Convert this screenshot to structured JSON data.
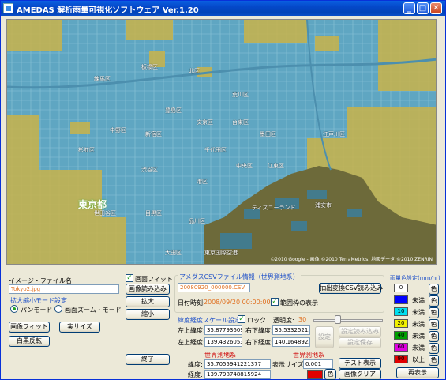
{
  "window": {
    "title": "AMEDAS 解析雨量可視化ソフトウェア Ver.1.20",
    "minimize": "_",
    "maximize": "□",
    "close": "✕"
  },
  "map": {
    "labels": [
      "東京都",
      "ディズニーランド",
      "浦安市",
      "東京国際空港",
      "江東区",
      "品川区",
      "目黒区",
      "渋谷区",
      "新宿区",
      "中野区",
      "杉並区",
      "練馬区",
      "板橋区",
      "北区",
      "荒川区",
      "台東区",
      "墨田区",
      "江戸川区",
      "大田区",
      "世田谷区",
      "豊島区",
      "文京区",
      "千代田区",
      "中央区",
      "港区"
    ],
    "copyright": "©2010 Google - 画像 ©2010 TerraMetrics, 地図データ ©2010 ZENRIN"
  },
  "image_panel": {
    "file_label": "イメージ・ファイル名",
    "file_value": "Tokyo2.jpg",
    "fit_check_label": "画面フィット",
    "fit_checked": true,
    "load_button": "画像読み込み",
    "zoom_in": "拡大",
    "zoom_out": "縮小",
    "zoom_mode_label": "拡大縮小モード設定",
    "pan_mode": "パンモード",
    "zoom_mode": "画面ズーム・モード",
    "fit_button": "画像フィット",
    "actual_size_button": "実サイズ",
    "invert_button": "白黒反転",
    "exit_button": "終了"
  },
  "csv_panel": {
    "title": "アメダスCSVファイル情報（世界測地系）",
    "file_value": "20080920_000000.CSV",
    "extract_button": "抽出変換CSV読み込み",
    "datetime_label": "日付時刻:",
    "datetime_value": "2008/09/20 00:00:00",
    "range_check_label": "範囲枠の表示",
    "range_checked": true
  },
  "latlon_panel": {
    "title": "緯度経度スケール設定",
    "lock_label": "ロック",
    "lock_checked": true,
    "transparency_label": "透明度:",
    "transparency_value": "30",
    "ul_lat_label": "左上緯度:",
    "ul_lat_value": "35.8779360901",
    "lr_lat_label": "右下緯度:",
    "lr_lat_value": "35.5332521541",
    "ul_lon_label": "左上経度:",
    "ul_lon_value": "139.432605398",
    "lr_lon_label": "右下経度:",
    "lr_lon_value": "140.164892233",
    "set_button": "設定",
    "load_settings": "設定読み込み",
    "save_settings": "設定保存"
  },
  "world_panel": {
    "title": "世界測地系",
    "lat_label": "緯度:",
    "lat_value": "35.7055941221377",
    "lon_label": "経度:",
    "lon_value": "139.798748815924",
    "title2": "世界測地系",
    "display_size_label": "表示サイズ:",
    "display_size_value": "0.001",
    "color_button": "色",
    "test_button": "テスト表示",
    "clear_button": "画像クリア",
    "marker_color": "#e00000"
  },
  "rain_panel": {
    "title": "雨量色設定(mm/hr)",
    "rows": [
      {
        "value": "0",
        "suffix": "",
        "color": "#ffffff"
      },
      {
        "value": "",
        "suffix": "未満",
        "color": "#0000ff"
      },
      {
        "value": "10",
        "suffix": "未満",
        "color": "#00e0f0"
      },
      {
        "value": "20",
        "suffix": "未満",
        "color": "#f0f000"
      },
      {
        "value": "40",
        "suffix": "未満",
        "color": "#00a000"
      },
      {
        "value": "60",
        "suffix": "未満",
        "color": "#e000e0"
      },
      {
        "value": "90",
        "suffix": "以上",
        "color": "#e00000"
      }
    ],
    "color_button": "色",
    "redisplay_button": "再表示"
  }
}
